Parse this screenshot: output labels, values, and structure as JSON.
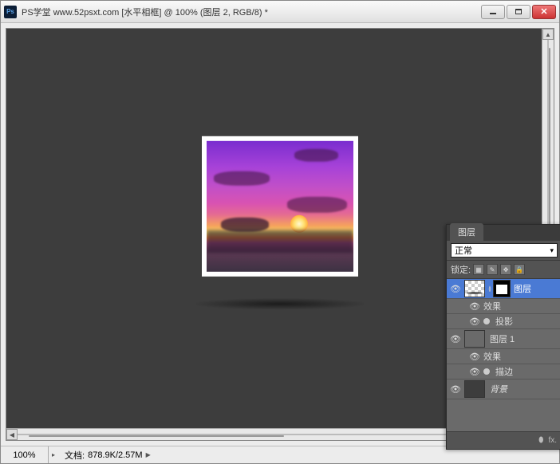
{
  "titlebar": {
    "ps_glyph": "Ps",
    "title": "PS学堂  www.52psxt.com [水平相框] @ 100% (图层 2, RGB/8) *"
  },
  "status": {
    "zoom": "100%",
    "doc_label": "文档:",
    "doc_size": "878.9K/2.57M",
    "arrow": "▶"
  },
  "layers_panel": {
    "tab": "图层",
    "blend_mode": "正常",
    "lock_label": "锁定:",
    "layers": [
      {
        "name": "图层",
        "selected": true,
        "thumb": "transparent-shadow",
        "has_mask": true,
        "fx_label": "效果",
        "fx_items": [
          "投影"
        ]
      },
      {
        "name": "图层 1",
        "selected": false,
        "thumb": "sunset",
        "has_mask": false,
        "fx_label": "效果",
        "fx_items": [
          "描边"
        ]
      },
      {
        "name": "背景",
        "selected": false,
        "thumb": "dark",
        "has_mask": false,
        "italic": true
      }
    ],
    "footer": {
      "link": "⬮",
      "fx": "fx."
    }
  }
}
